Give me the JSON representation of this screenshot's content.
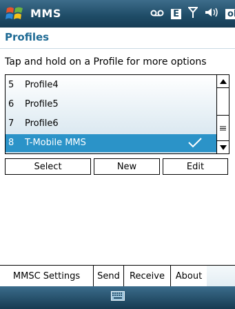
{
  "app": {
    "title": "MMS",
    "section_title": "Profiles"
  },
  "status": {
    "e_label": "E",
    "ok_label": "ok"
  },
  "instruction": "Tap and hold on a Profile for more options",
  "profiles": [
    {
      "num": "5",
      "name": "Profile4",
      "selected": false
    },
    {
      "num": "6",
      "name": "Profile5",
      "selected": false
    },
    {
      "num": "7",
      "name": "Profile6",
      "selected": false
    },
    {
      "num": "8",
      "name": "T-Mobile MMS",
      "selected": true
    }
  ],
  "buttons": {
    "select": "Select",
    "new": "New",
    "edit": "Edit"
  },
  "tabs": [
    "MMSC Settings",
    "Send",
    "Receive",
    "About"
  ],
  "colors": {
    "selection": "#2b93c8",
    "title_bar": "#1e4b66",
    "section_title": "#1e6a94"
  }
}
